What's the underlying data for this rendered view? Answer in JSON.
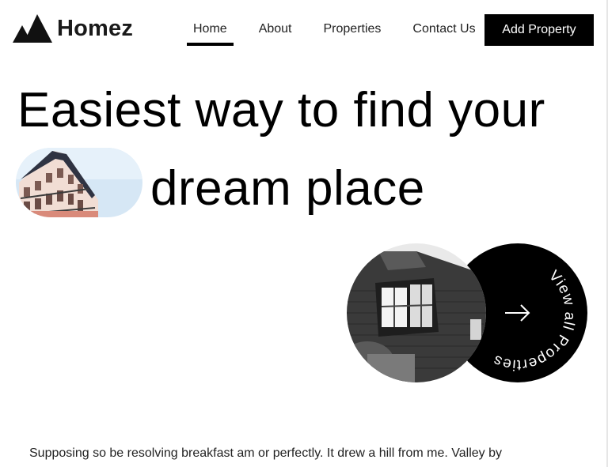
{
  "brand": {
    "name": "Homez"
  },
  "nav": {
    "items": [
      {
        "label": "Home",
        "active": true
      },
      {
        "label": "About",
        "active": false
      },
      {
        "label": "Properties",
        "active": false
      },
      {
        "label": "Contact Us",
        "active": false
      }
    ],
    "cta_label": "Add Property"
  },
  "hero": {
    "line1": "Easiest way to find your",
    "line2": "dream place"
  },
  "cta_circle": {
    "label": "View all Properties",
    "icon": "arrow-right-icon"
  },
  "intro": {
    "text": "Supposing so be resolving breakfast am or perfectly. It drew a hill from me. Valley by"
  },
  "colors": {
    "primary": "#000000",
    "background": "#ffffff",
    "text": "#111111"
  }
}
